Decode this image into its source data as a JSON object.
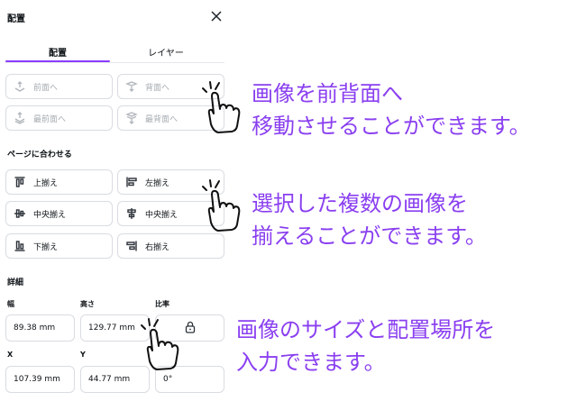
{
  "panel": {
    "title": "配置",
    "tabs": [
      {
        "label": "配置",
        "active": true
      },
      {
        "label": "レイヤー",
        "active": false
      }
    ],
    "order_buttons": [
      {
        "label": "前面へ",
        "icon": "bring-forward-icon"
      },
      {
        "label": "背面へ",
        "icon": "send-backward-icon"
      },
      {
        "label": "最前面へ",
        "icon": "bring-to-front-icon"
      },
      {
        "label": "最背面へ",
        "icon": "send-to-back-icon"
      }
    ],
    "align_section_label": "ページに合わせる",
    "align_buttons": [
      {
        "label": "上揃え",
        "icon": "align-top-icon"
      },
      {
        "label": "左揃え",
        "icon": "align-left-icon"
      },
      {
        "label": "中央揃え",
        "icon": "align-middle-icon"
      },
      {
        "label": "中央揃え",
        "icon": "align-center-icon"
      },
      {
        "label": "下揃え",
        "icon": "align-bottom-icon"
      },
      {
        "label": "右揃え",
        "icon": "align-right-icon"
      }
    ],
    "details_section_label": "詳細",
    "width_label": "幅",
    "width_value": "89.38 mm",
    "height_label": "高さ",
    "height_value": "129.77 mm",
    "ratio_label": "比率",
    "x_label": "X",
    "x_value": "107.39 mm",
    "y_label": "Y",
    "y_value": "44.77 mm",
    "rotation_value": "0°"
  },
  "annotations": {
    "a1_line1": "画像を前背面へ",
    "a1_line2": "移動させることができます。",
    "a2_line1": "選択した複数の画像を",
    "a2_line2": "揃えることができます。",
    "a3_line1": "画像のサイズと配置場所を",
    "a3_line2": "入力できます。"
  },
  "colors": {
    "accent": "#8b3dff",
    "annotation": "#8a3ff0"
  }
}
